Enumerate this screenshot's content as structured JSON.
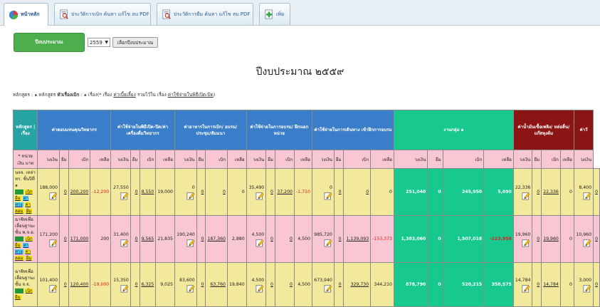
{
  "tabs": [
    {
      "label": "หน้าหลัก",
      "active": true,
      "icon": "pie-chart-icon"
    },
    {
      "label": "ประวัติการเบิก ค้นหา แก้ไข ลบ PDF",
      "icon": "search-document-icon"
    },
    {
      "label": "ประวัติการยืม ค้นหา แก้ไข ลบ PDF",
      "icon": "search-document-icon"
    },
    {
      "label": "เพิ่ม",
      "icon": "add-document-icon"
    }
  ],
  "controls": {
    "budget_button": "ปีงบประมาณ",
    "year_value": "2559",
    "choose_button": "เลือกปีงบประมาณ"
  },
  "title": "ปีงบประมาณ ๒๕๕๙",
  "meta": {
    "part1": "หลักสูตร : ๑ หลักสูตร",
    "part2": "หัวเรื่องเบิก",
    "part3": ": ๑ เรื่อง(* เรื่อง",
    "part4": "ค่าเบี้ยเลี้ยง",
    "part5": "รวมไว้ใน เรื่อง",
    "part6": "ค่าใช้จ่ายในพิธีเปิด-ปิด",
    "part7": ")"
  },
  "headers": [
    "หลักสูตร | เรื่อง",
    "ค่าตอบแทนคุณวิทยากร",
    "ค่าใช้จ่ายในพิธีเปิด-ปิด/ค่าเครื่องดื่มวิทยากร",
    "ค่าอาหารในการเบิก/ อบรม/ประชุม/สัมมนา",
    "ค่าใช้จ่ายในการอบรม/ ฝึกนอกหน่วย",
    "ค่าใช้จ่ายในการเดินทาง เข้าฝึกการอบรม",
    "งานกลุ่ม ๑",
    "ค่าน้ำมันเชื้อเพลิง/ หล่อลื่น/แก๊สหุงต้ม",
    "ค่าวั"
  ],
  "subheaders": {
    "unit_label": "* หน่วยเงิน บาท",
    "budget": "วงเงิน",
    "borrow": "ยืม",
    "withdraw": "เบิก",
    "remain": "เหลือ"
  },
  "rows": [
    {
      "name": "นจจ. เหล่า ทร. ชั้นปีที่ ๑",
      "links": [
        "เบิกยืม",
        "ค่าทาง",
        "ค่าลอม",
        "ยืม"
      ],
      "g1": [
        "188,000",
        "0",
        "200,200",
        "-12,200"
      ],
      "g2": [
        "27,550",
        "0",
        "8,550",
        "19,000"
      ],
      "g3": [
        "0",
        "0",
        "0",
        "0"
      ],
      "g4": [
        "35,490",
        "0",
        "37,200",
        "-1,710"
      ],
      "g5": [
        "0",
        "0",
        "0",
        "0"
      ],
      "g6": [
        "251,040",
        "0",
        "245,950",
        "5,090"
      ],
      "g7": [
        "22,336",
        "0",
        "22,336",
        "0"
      ],
      "g8": [
        "8,400",
        "0"
      ]
    },
    {
      "name": "ฉาซิทเพื่อเลื่อนฐานะชั้น พ.จ.อ.",
      "links": [
        "เบิกยืม",
        "ค่าทาง",
        "ค่าลอม",
        "ยืม"
      ],
      "g1": [
        "171,200",
        "0",
        "171,000",
        "200"
      ],
      "g2": [
        "31,400",
        "0",
        "9,565",
        "21,835"
      ],
      "g3": [
        "190,240",
        "0",
        "187,360",
        "2,880"
      ],
      "g4": [
        "4,500",
        "0",
        "0",
        "4,500"
      ],
      "g5": [
        "985,720",
        "0",
        "1,139,093",
        "-153,373"
      ],
      "g6": [
        "1,383,060",
        "0",
        "1,507,018",
        "-123,958"
      ],
      "g7": [
        "19,960",
        "0",
        "19,960",
        "0"
      ],
      "g8": [
        "10,960",
        "0"
      ]
    },
    {
      "name": "ฉาซิทเพื่อเลื่อนฐานะชั้น จ.จ.",
      "links": [
        "เบิกยืม"
      ],
      "g1": [
        "101,400",
        "0",
        "120,400",
        "-19,000"
      ],
      "g2": [
        "15,350",
        "0",
        "6,325",
        "9,025"
      ],
      "g3": [
        "83,600",
        "0",
        "63,760",
        "19,840"
      ],
      "g4": [
        "4,500",
        "0",
        "0",
        "4,500"
      ],
      "g5": [
        "673,940",
        "0",
        "329,730",
        "344,210"
      ],
      "g6": [
        "878,790",
        "0",
        "520,215",
        "358,575"
      ],
      "g7": [
        "14,784",
        "0",
        "14,784",
        "0"
      ],
      "g8": [
        "3,000",
        "0"
      ]
    }
  ],
  "colors": {
    "teal": "#26a3a3",
    "blue": "#3a7dc9",
    "green": "#18c98f",
    "maroon": "#8b1414",
    "pink": "#f8c7d3",
    "yellow": "#f2e99c",
    "button_green": "#4cae4c",
    "negative": "#e31b1b"
  }
}
